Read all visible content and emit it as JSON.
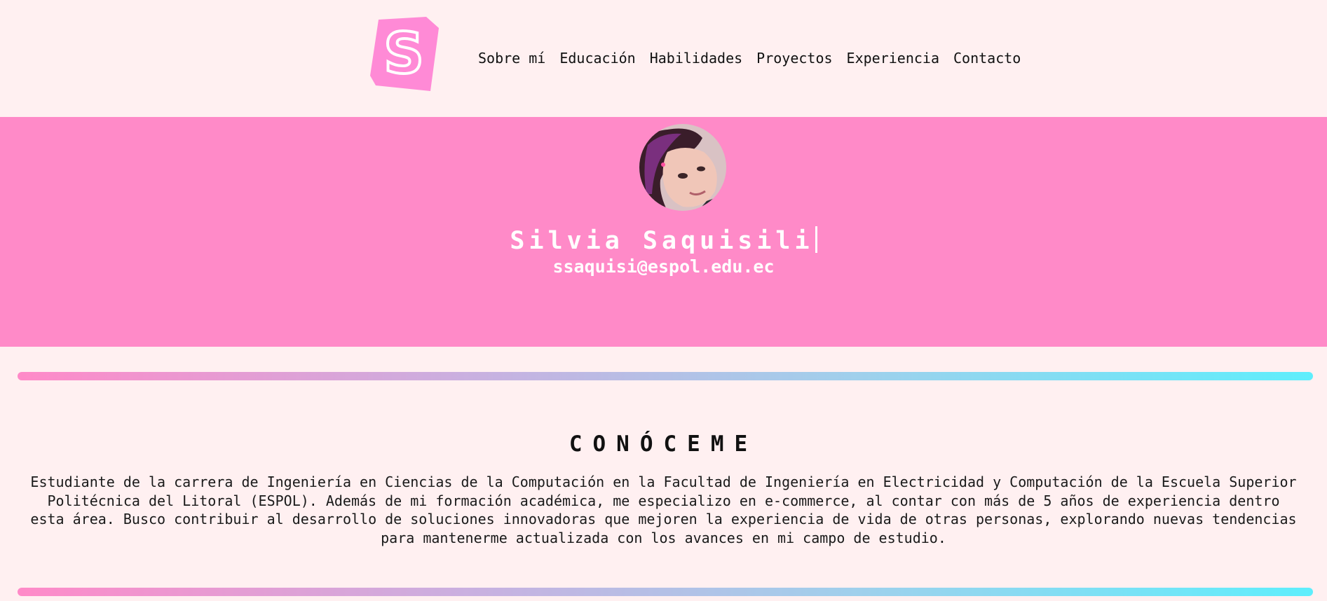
{
  "brand": {
    "logo_letter": "S"
  },
  "nav": {
    "items": [
      {
        "label": "Sobre mí"
      },
      {
        "label": "Educación"
      },
      {
        "label": "Habilidades"
      },
      {
        "label": "Proyectos"
      },
      {
        "label": "Experiencia"
      },
      {
        "label": "Contacto"
      }
    ]
  },
  "hero": {
    "name": "Silvia Saquisili",
    "email": "ssaquisi@espol.edu.ec",
    "avatar_icon": "profile-photo"
  },
  "about": {
    "title": "CONÓCEME",
    "text": "Estudiante de la carrera de Ingeniería en Ciencias de la Computación en la Facultad de Ingeniería en Electricidad y Computación de la Escuela Superior Politécnica del Litoral (ESPOL). Además de mi formación académica, me especializo en e-commerce, al contar con más de 5 años de experiencia dentro esta área. Busco contribuir al desarrollo de soluciones innovadoras que mejoren la experiencia de vida de otras personas, explorando nuevas tendencias para mantenerme actualizada con los avances en mi campo de estudio."
  },
  "colors": {
    "background": "#fff0f1",
    "hero_pink": "#ff8ac8",
    "gradient_start": "#ff8ac8",
    "gradient_end": "#5eeefc"
  }
}
